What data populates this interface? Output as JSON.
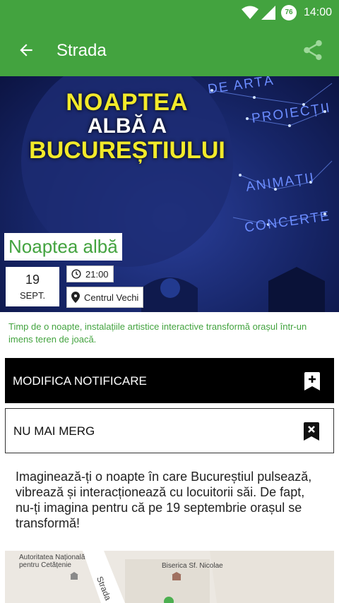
{
  "status_bar": {
    "time": "14:00",
    "battery": "76"
  },
  "app_bar": {
    "title": "Strada"
  },
  "poster": {
    "line1": "NOAPTEA",
    "line2": "ALBĂ A",
    "line3": "BUCUREȘTIULUI",
    "words": [
      "DE ARTĂ",
      "PROIECȚII",
      "ANIMAȚII",
      "CONCERTE"
    ]
  },
  "event": {
    "title": "Noaptea albă",
    "day": "19",
    "month": "SEPT.",
    "time": "21:00",
    "location": "Centrul Vechi",
    "tagline": "Timp de o noapte, instalațiile artistice interactive transformă orașul într-un imens teren de joacă."
  },
  "actions": {
    "modify_label": "MODIFICA NOTIFICARE",
    "not_going_label": "NU MAI MERG"
  },
  "description": "Imaginează-ți o noapte în care Bucureștiul pulsează, vibrează și interacționează cu locuitorii săi. De fapt, nu-ți imagina pentru că pe 19 septembrie orașul se transformă!",
  "map": {
    "label1": "Autoritatea Națională pentru Cetățenie",
    "label2": "Biserica Sf. Nicolae",
    "street": "Strada"
  },
  "colors": {
    "accent": "#43a33f",
    "dark": "#000000"
  }
}
